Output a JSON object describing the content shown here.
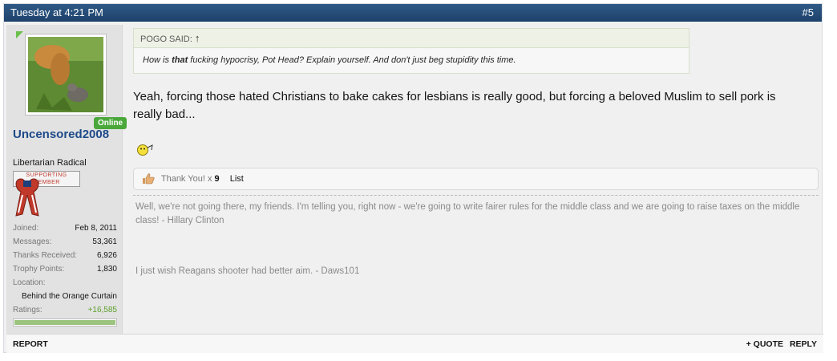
{
  "post": {
    "date": "Tuesday at 4:21 PM",
    "number": "#5"
  },
  "user": {
    "online_label": "Online",
    "username": "Uncensored2008",
    "title": "Libertarian Radical",
    "badge_line1": "SUPPORTING",
    "badge_line2": "MEMBER",
    "stats": {
      "joined_label": "Joined:",
      "joined_value": "Feb 8, 2011",
      "messages_label": "Messages:",
      "messages_value": "53,361",
      "thanks_label": "Thanks Received:",
      "thanks_value": "6,926",
      "trophy_label": "Trophy Points:",
      "trophy_value": "1,830",
      "location_label": "Location:",
      "location_value": "Behind the Orange Curtain",
      "ratings_label": "Ratings:",
      "ratings_value": "+16,585"
    },
    "rating_fraction": 1.0
  },
  "quote": {
    "header": "POGO SAID:",
    "body_before": "How is ",
    "body_bold": "that",
    "body_after": " fucking hypocrisy, Pot Head? Explain yourself. And don't just beg stupidity this time."
  },
  "message": "Yeah, forcing those hated Christians to bake cakes for lesbians is really good, but forcing a beloved Muslim to sell pork is really bad...",
  "likes": {
    "label": "Thank You! x",
    "count": "9",
    "list_label": "List"
  },
  "signature": {
    "line1": "Well, we're not going there, my friends. I'm telling you, right now - we're going to write fairer rules for the middle class and we are going to raise taxes on the middle class! - Hillary Clinton",
    "line2": "I just wish Reagans shooter had better aim. - Daws101"
  },
  "footer": {
    "report": "REPORT",
    "quote": "+ QUOTE",
    "reply": "REPLY"
  },
  "colors": {
    "header_bg": "#1d416b",
    "username": "#1d4a8a",
    "online": "#4aa83a",
    "ratings": "#5ea02c"
  }
}
